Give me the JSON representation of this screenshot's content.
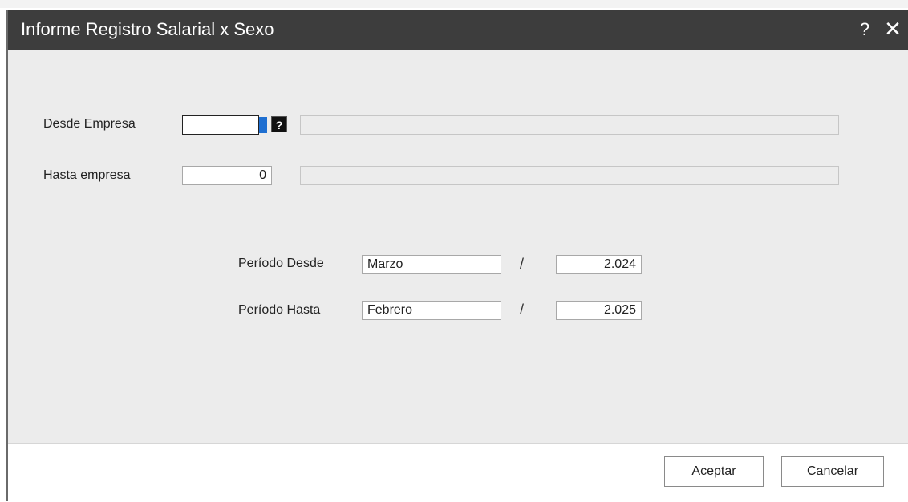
{
  "dialog": {
    "title": "Informe Registro Salarial x Sexo",
    "help_label": "?",
    "close_label": "✕"
  },
  "empresa": {
    "desde_label": "Desde Empresa",
    "desde_value": "",
    "desde_lookup": "?",
    "desde_name": "",
    "hasta_label": "Hasta empresa",
    "hasta_value": "0",
    "hasta_name": ""
  },
  "periodo": {
    "desde_label": "Período Desde",
    "desde_month": "Marzo",
    "desde_year": "2.024",
    "hasta_label": "Período Hasta",
    "hasta_month": "Febrero",
    "hasta_year": "2.025",
    "separator": "/"
  },
  "footer": {
    "accept_label": "Aceptar",
    "cancel_label": "Cancelar"
  }
}
